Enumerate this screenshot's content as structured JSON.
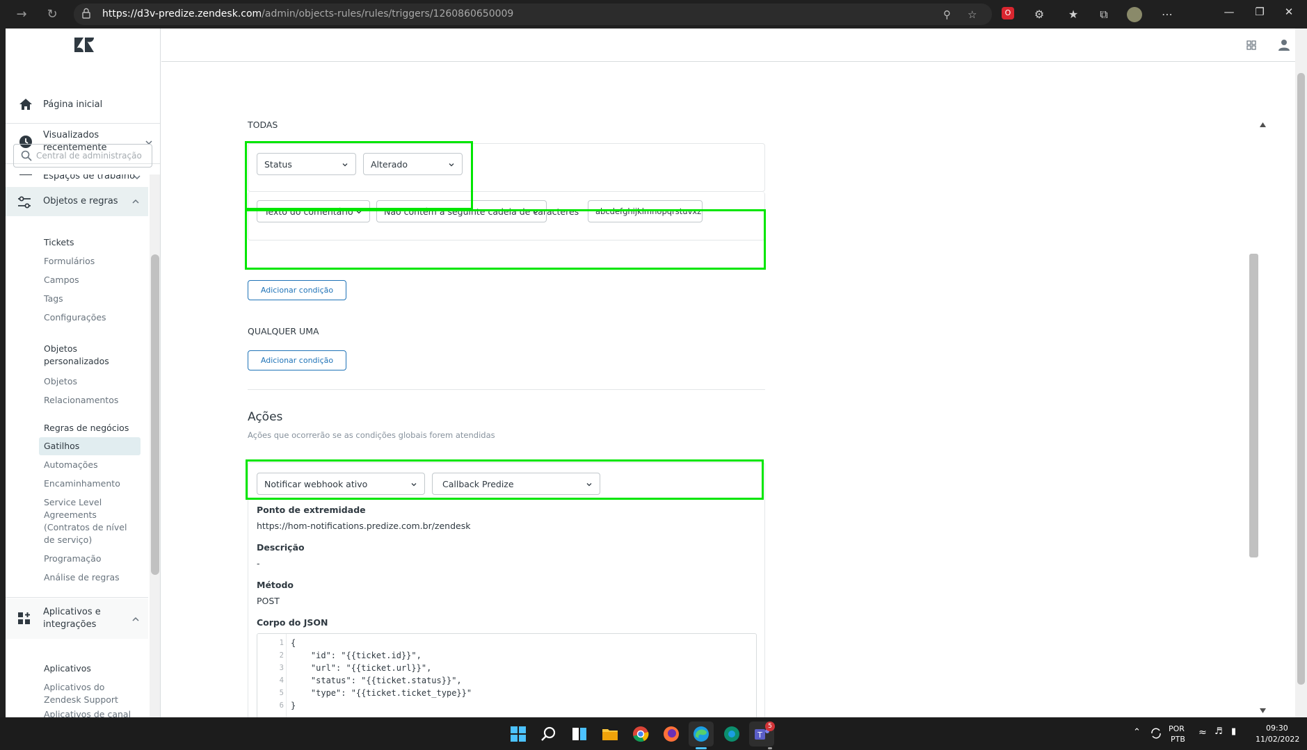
{
  "browser": {
    "url_host": "https://d3v-predize.zendesk.com",
    "url_path": "/admin/objects-rules/rules/triggers/1260860650009"
  },
  "sidebar": {
    "home": "Página inicial",
    "recent": "Visualizados recentemente",
    "search_placeholder": "Central de administração",
    "workspaces": "Espaços de trabalho",
    "objects_rules": "Objetos e regras",
    "tickets_header": "Tickets",
    "tickets_items": [
      "Formulários",
      "Campos",
      "Tags",
      "Configurações"
    ],
    "custom_objects_header": "Objetos personalizados",
    "custom_objects_items": [
      "Objetos",
      "Relacionamentos"
    ],
    "business_rules_header": "Regras de negócios",
    "business_rules_items": [
      "Gatilhos",
      "Automações",
      "Encaminhamento",
      "Service Level Agreements (Contratos de nível de serviço)",
      "Programação",
      "Análise de regras"
    ],
    "apps_section": "Aplicativos e integrações",
    "apps_header": "Aplicativos",
    "apps_items": [
      "Aplicativos do Zendesk Support",
      "Aplicativos de canal"
    ]
  },
  "conditions": {
    "all_label": "TODAS",
    "row1": {
      "field": "Status",
      "operator": "Alterado"
    },
    "row2": {
      "field": "Texto do comentário",
      "operator": "Não contém a seguinte cadeia de caracteres",
      "value": "abcdefghijklmnopqrstuvxz"
    },
    "add_condition": "Adicionar condição",
    "any_label": "QUALQUER UMA",
    "add_condition_any": "Adicionar condição"
  },
  "actions": {
    "title": "Ações",
    "subtitle": "Ações que ocorrerão se as condições globais forem atendidas",
    "action": "Notificar webhook ativo",
    "target": "Callback Predize",
    "endpoint_label": "Ponto de extremidade",
    "endpoint_value": "https://hom-notifications.predize.com.br/zendesk",
    "desc_label": "Descrição",
    "desc_value": "-",
    "method_label": "Método",
    "method_value": "POST",
    "json_label": "Corpo do JSON",
    "json_lines": [
      "{",
      "    \"id\": \"{{ticket.id}}\",",
      "    \"url\": \"{{ticket.url}}\",",
      "    \"status\": \"{{ticket.status}}\",",
      "    \"type\": \"{{ticket.ticket_type}}\"",
      "}"
    ],
    "line_numbers": [
      "1",
      "2",
      "3",
      "4",
      "5",
      "6"
    ]
  },
  "taskbar": {
    "lang": "POR",
    "layout": "PTB",
    "time": "09:30",
    "date": "11/02/2022",
    "teams_badge": "5"
  },
  "colors": {
    "highlight": "#00e600",
    "accent_blue": "#1f73b7",
    "sidebar_active": "#e9f0f1"
  }
}
